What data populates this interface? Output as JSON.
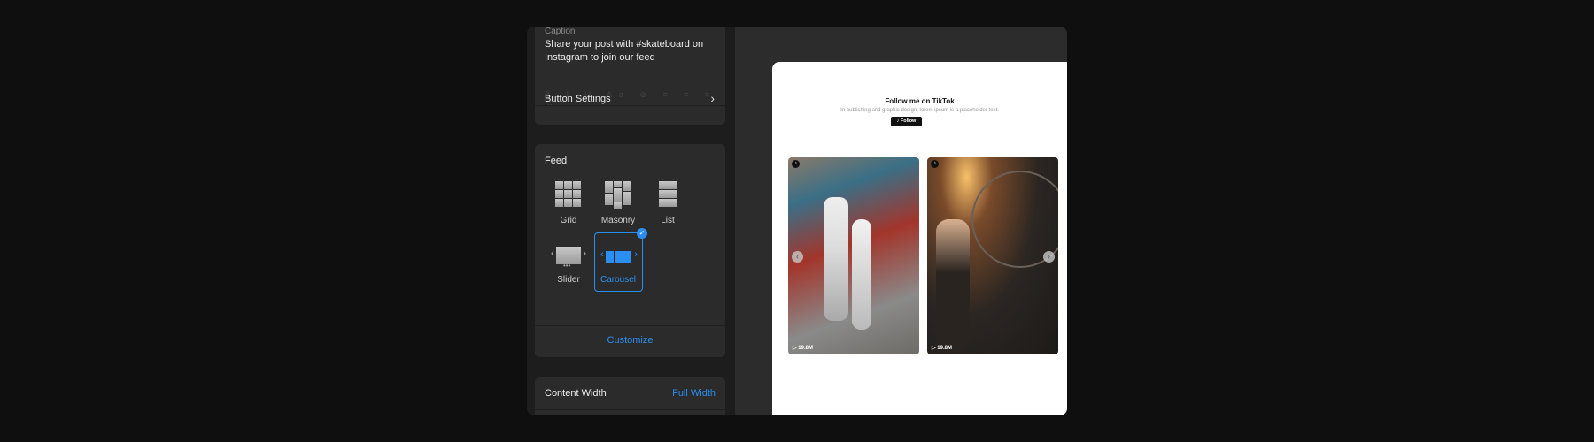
{
  "caption": {
    "label": "Caption",
    "text": "Share your post with #skateboard on Instagram to join our feed"
  },
  "button_settings": {
    "label": "Button Settings"
  },
  "feed": {
    "title": "Feed",
    "layouts": [
      {
        "label": "Grid"
      },
      {
        "label": "Masonry"
      },
      {
        "label": "List"
      },
      {
        "label": "Slider"
      },
      {
        "label": "Carousel",
        "selected": true
      }
    ],
    "customize": "Customize"
  },
  "content_width": {
    "label": "Content Width",
    "value": "Full Width"
  },
  "preview": {
    "title": "Follow me on TikTok",
    "subtitle": "In publishing and graphic design, lorem ipsum is a placeholder text.",
    "follow": "Follow",
    "posts": [
      {
        "views": "19.8M"
      },
      {
        "views": "19.8M"
      }
    ]
  },
  "colors": {
    "accent": "#2a8ff0",
    "panel": "#2b2b2b"
  }
}
